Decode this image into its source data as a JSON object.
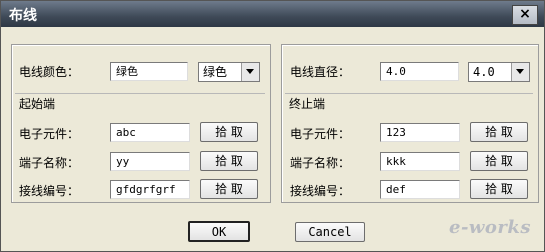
{
  "window": {
    "title": "布线",
    "close_label": "×"
  },
  "wire_color": {
    "label": "电线颜色：",
    "value": "绿色",
    "select_value": "绿色"
  },
  "wire_diameter": {
    "label": "电线直径：",
    "value": "4.0",
    "select_value": "4.0"
  },
  "start_end": {
    "group_label": "起始端",
    "component_label": "电子元件：",
    "component_value": "abc",
    "terminal_label": "端子名称：",
    "terminal_value": "yy",
    "wire_no_label": "接线编号：",
    "wire_no_value": "gfdgrfgrf",
    "pick_label": "拾 取"
  },
  "finish_end": {
    "group_label": "终止端",
    "component_label": "电子元件：",
    "component_value": "123",
    "terminal_label": "端子名称：",
    "terminal_value": "kkk",
    "wire_no_label": "接线编号：",
    "wire_no_value": "def",
    "pick_label": "拾 取"
  },
  "footer": {
    "ok_label": "OK",
    "cancel_label": "Cancel"
  },
  "watermark": "e-works",
  "colors": {
    "titlebar": "#3f4a58",
    "dialog_bg": "#ece9d8"
  }
}
